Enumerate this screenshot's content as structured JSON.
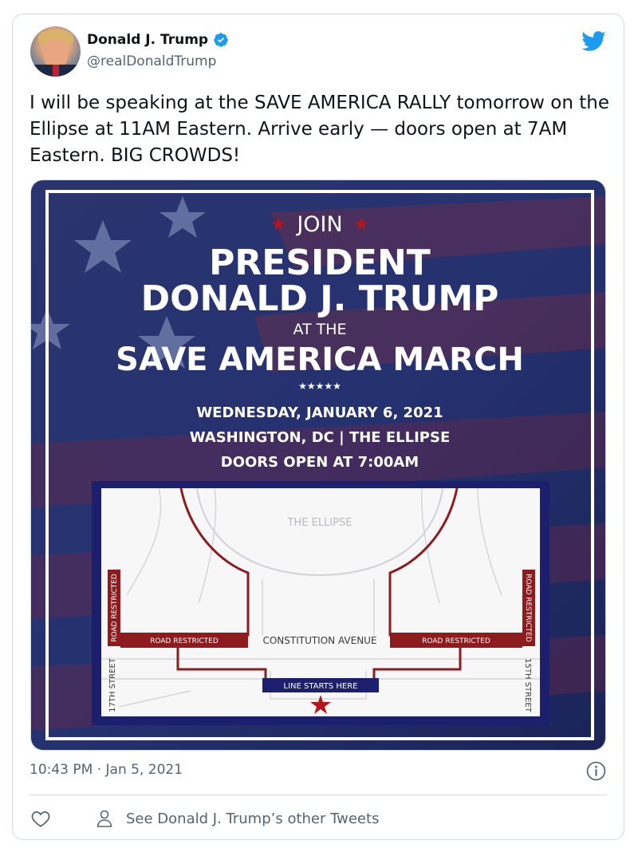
{
  "author": {
    "display_name": "Donald J. Trump",
    "handle": "@realDonaldTrump"
  },
  "tweet": {
    "text": "I will be speaking at the SAVE AMERICA RALLY tomorrow on the Ellipse at 11AM Eastern. Arrive early — doors open at 7AM Eastern. BIG CROWDS!",
    "timestamp": "10:43 PM · Jan 5, 2021"
  },
  "poster": {
    "join": "JOIN",
    "headline_line1": "PRESIDENT",
    "headline_line2": "DONALD J. TRUMP",
    "at_the": "AT THE",
    "event_name": "SAVE AMERICA MARCH",
    "stars": "★★★★★",
    "date_line": "WEDNESDAY, JANUARY 6, 2021",
    "location_line": "WASHINGTON, DC | THE ELLIPSE",
    "doors_line": "DOORS OPEN AT 7:00AM"
  },
  "map": {
    "ellipse_label": "THE ELLIPSE",
    "road_restricted": "ROAD RESTRICTED",
    "constitution_avenue": "CONSTITUTION AVENUE",
    "line_starts_here": "LINE STARTS HERE",
    "street_17th": "17TH STREET",
    "street_15th": "15TH STREET"
  },
  "footer": {
    "see_other_tweets": "See Donald J. Trump’s other Tweets"
  },
  "icons": {
    "verified": "verified-badge-icon",
    "bird": "twitter-bird-icon",
    "info": "info-icon",
    "like": "heart-icon",
    "profile": "person-icon"
  },
  "colors": {
    "twitter_blue": "#1d9bf0",
    "text_primary": "#0f1419",
    "text_secondary": "#536471",
    "poster_navy": "#1f2a6b",
    "restricted_red": "#8e1b1e",
    "star_red": "#b3161c"
  }
}
